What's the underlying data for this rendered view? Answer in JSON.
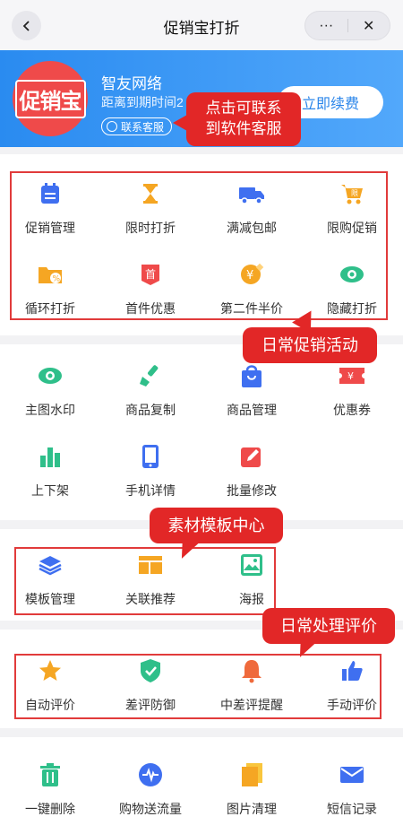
{
  "navbar": {
    "title": "促销宝打折",
    "more_label": "···",
    "close_label": "✕"
  },
  "banner": {
    "logo_text": "促销宝",
    "company": "智友网络",
    "expire_label": "距离到期时间2",
    "contact_label": "联系客服",
    "renew_label": "立即续费"
  },
  "annotations": {
    "contact": "点击可联系\n到软件客服",
    "daily": "日常促销活动",
    "material": "素材模板中心",
    "review": "日常处理评价"
  },
  "sections": {
    "promo": [
      {
        "label": "促销管理"
      },
      {
        "label": "限时打折"
      },
      {
        "label": "满减包邮"
      },
      {
        "label": "限购促销"
      },
      {
        "label": "循环打折"
      },
      {
        "label": "首件优惠"
      },
      {
        "label": "第二件半价"
      },
      {
        "label": "隐藏打折"
      }
    ],
    "tools": [
      {
        "label": "主图水印"
      },
      {
        "label": "商品复制"
      },
      {
        "label": "商品管理"
      },
      {
        "label": "优惠券"
      },
      {
        "label": "上下架"
      },
      {
        "label": "手机详情"
      },
      {
        "label": "批量修改"
      }
    ],
    "material": [
      {
        "label": "模板管理"
      },
      {
        "label": "关联推荐"
      },
      {
        "label": "海报"
      }
    ],
    "review": [
      {
        "label": "自动评价"
      },
      {
        "label": "差评防御"
      },
      {
        "label": "中差评提醒"
      },
      {
        "label": "手动评价"
      }
    ],
    "misc": [
      {
        "label": "一键删除"
      },
      {
        "label": "购物送流量"
      },
      {
        "label": "图片清理"
      },
      {
        "label": "短信记录"
      }
    ]
  },
  "badges": {
    "first_item": "首",
    "limit_buy": "限",
    "coupon": "¥",
    "second_half": "¥"
  },
  "colors": {
    "banner_start": "#2a8bf0",
    "banner_end": "#52a8fb",
    "accent_red": "#e22727",
    "icon_blue": "#3f6ff0",
    "icon_orange": "#f5a623",
    "icon_green": "#2fbf8a",
    "icon_red": "#ef4a4a"
  }
}
